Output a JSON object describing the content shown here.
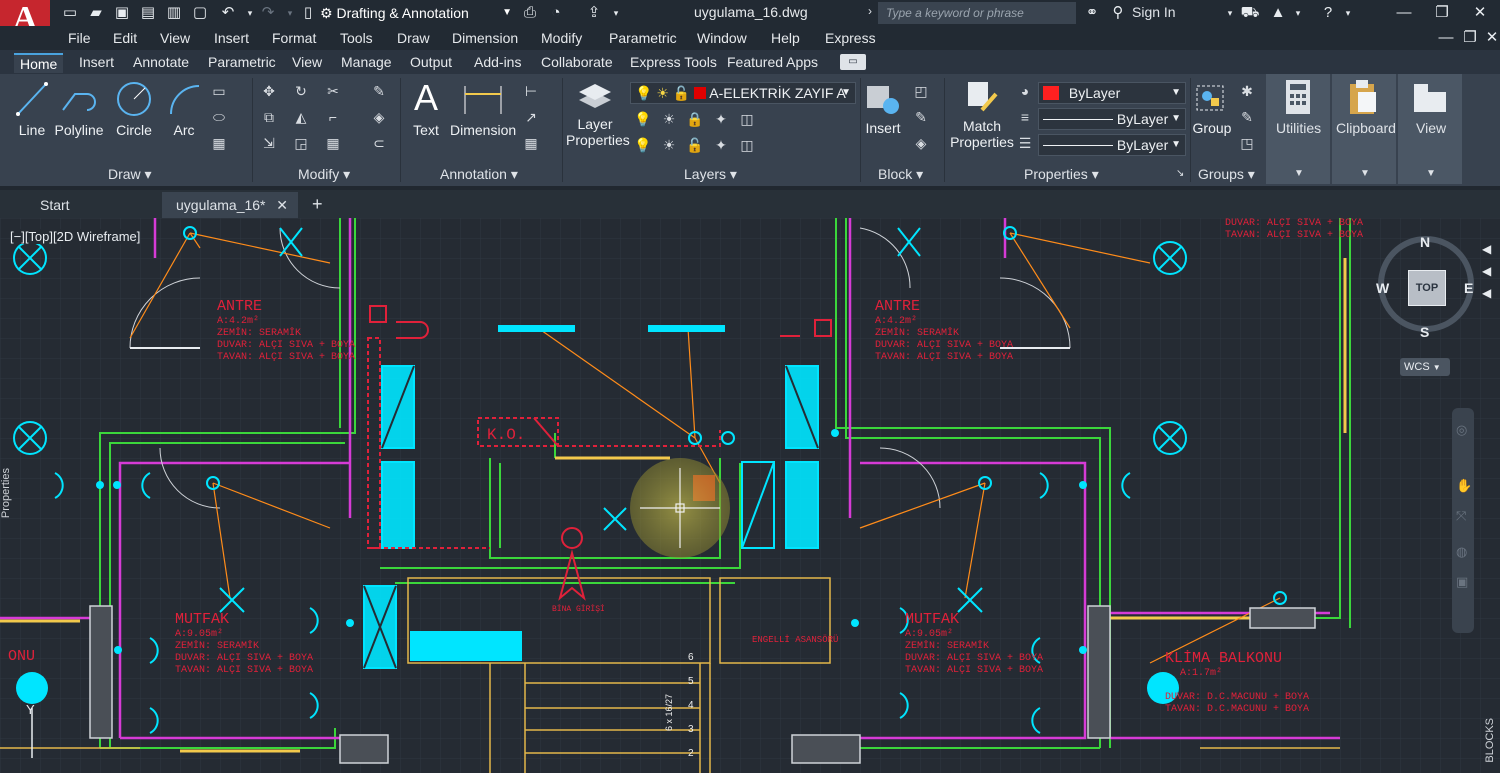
{
  "app": {
    "logo_letter": "A",
    "workspace": "Drafting & Annotation",
    "file_title": "uygulama_16.dwg",
    "search_placeholder": "Type a keyword or phrase",
    "sign_in": "Sign In"
  },
  "menu": [
    "File",
    "Edit",
    "View",
    "Insert",
    "Format",
    "Tools",
    "Draw",
    "Dimension",
    "Modify",
    "Parametric",
    "Window",
    "Help",
    "Express"
  ],
  "ribbon_tabs": [
    "Home",
    "Insert",
    "Annotate",
    "Parametric",
    "View",
    "Manage",
    "Output",
    "Add-ins",
    "Collaborate",
    "Express Tools",
    "Featured Apps"
  ],
  "ribbon": {
    "draw": {
      "title": "Draw",
      "line": "Line",
      "polyline": "Polyline",
      "circle": "Circle",
      "arc": "Arc"
    },
    "modify": {
      "title": "Modify"
    },
    "annotation": {
      "title": "Annotation",
      "text": "Text",
      "dimension": "Dimension"
    },
    "layers": {
      "title": "Layers",
      "layer_properties_1": "Layer",
      "layer_properties_2": "Properties",
      "current_layer": "A-ELEKTRİK ZAYIF A"
    },
    "block": {
      "title": "Block",
      "insert": "Insert"
    },
    "properties": {
      "title": "Properties",
      "match_1": "Match",
      "match_2": "Properties",
      "color": "ByLayer",
      "linetype": "ByLayer",
      "lineweight": "ByLayer"
    },
    "groups": {
      "title": "Groups",
      "group": "Group"
    },
    "utilities": "Utilities",
    "clipboard": "Clipboard",
    "view": "View"
  },
  "doc_tabs": {
    "start": "Start",
    "active": "uygulama_16*"
  },
  "viewport": {
    "label": "[−][Top][2D Wireframe]",
    "compass": {
      "n": "N",
      "s": "S",
      "e": "E",
      "w": "W",
      "top": "TOP",
      "wcs": "WCS"
    },
    "side_left": "Properties",
    "side_right": "BLOCKS"
  },
  "drawing": {
    "antre_title": "ANTRE",
    "antre_area": "A:4.2m²",
    "zemin": "ZEMİN: SERAMİK",
    "duvar_alci": "DUVAR: ALÇI SIVA + BOYA",
    "tavan_alci": "TAVAN: ALÇI SIVA + BOYA",
    "mutfak_title": "MUTFAK",
    "mutfak_area": "A:9.05m²",
    "klima_title": "KLİMA BALKONU",
    "klima_area": "A:1.7m²",
    "duvar_dc": "DUVAR: D.C.MACUNU + BOYA",
    "tavan_dc": "TAVAN: D.C.MACUNU + BOYA",
    "ko": "K.O.",
    "engelli": "ENGELLİ ASANSÖRÜ",
    "bina_girisi": "BİNA GİRİŞİ",
    "onu": "ONU",
    "stair_nums": [
      "6",
      "5",
      "4",
      "3",
      "2"
    ],
    "stair_dim": "6 x 16/27",
    "colors": {
      "wall_green": "#3bd63b",
      "magenta": "#d63bd6",
      "cyan": "#00e5ff",
      "orange": "#ff8c1a",
      "yellow": "#e3b84a",
      "red": "#e0213a"
    }
  }
}
